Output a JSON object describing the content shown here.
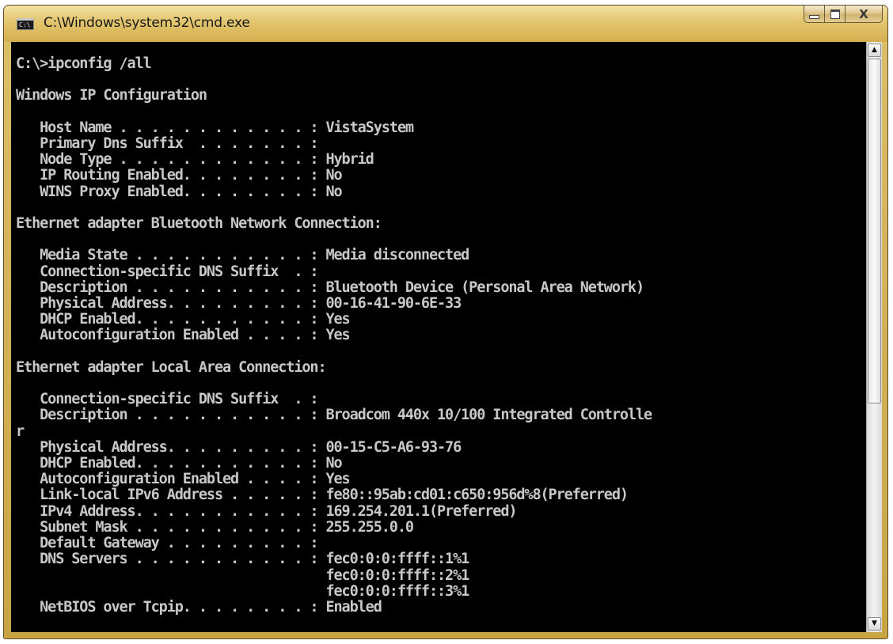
{
  "window": {
    "title": "C:\\Windows\\system32\\cmd.exe",
    "icon_text": "C:\\",
    "buttons": {
      "minimize": "minimize-icon",
      "maximize": "maximize-icon",
      "close": "X"
    }
  },
  "scrollbar": {
    "up_arrow": "▲",
    "down_arrow": "▼"
  },
  "colors": {
    "frame_accent": "#d5af4e",
    "console_bg": "#000000",
    "console_text": "#c8c8c8"
  },
  "console": {
    "lines": [
      "C:\\>ipconfig /all",
      "",
      "Windows IP Configuration",
      "",
      "   Host Name . . . . . . . . . . . . : VistaSystem",
      "   Primary Dns Suffix  . . . . . . . :",
      "   Node Type . . . . . . . . . . . . : Hybrid",
      "   IP Routing Enabled. . . . . . . . : No",
      "   WINS Proxy Enabled. . . . . . . . : No",
      "",
      "Ethernet adapter Bluetooth Network Connection:",
      "",
      "   Media State . . . . . . . . . . . : Media disconnected",
      "   Connection-specific DNS Suffix  . :",
      "   Description . . . . . . . . . . . : Bluetooth Device (Personal Area Network)",
      "   Physical Address. . . . . . . . . : 00-16-41-90-6E-33",
      "   DHCP Enabled. . . . . . . . . . . : Yes",
      "   Autoconfiguration Enabled . . . . : Yes",
      "",
      "Ethernet adapter Local Area Connection:",
      "",
      "   Connection-specific DNS Suffix  . :",
      "   Description . . . . . . . . . . . : Broadcom 440x 10/100 Integrated Controlle",
      "r",
      "   Physical Address. . . . . . . . . : 00-15-C5-A6-93-76",
      "   DHCP Enabled. . . . . . . . . . . : No",
      "   Autoconfiguration Enabled . . . . : Yes",
      "   Link-local IPv6 Address . . . . . : fe80::95ab:cd01:c650:956d%8(Preferred)",
      "   IPv4 Address. . . . . . . . . . . : 169.254.201.1(Preferred)",
      "   Subnet Mask . . . . . . . . . . . : 255.255.0.0",
      "   Default Gateway . . . . . . . . . :",
      "   DNS Servers . . . . . . . . . . . : fec0:0:0:ffff::1%1",
      "                                       fec0:0:0:ffff::2%1",
      "                                       fec0:0:0:ffff::3%1",
      "   NetBIOS over Tcpip. . . . . . . . : Enabled"
    ]
  }
}
